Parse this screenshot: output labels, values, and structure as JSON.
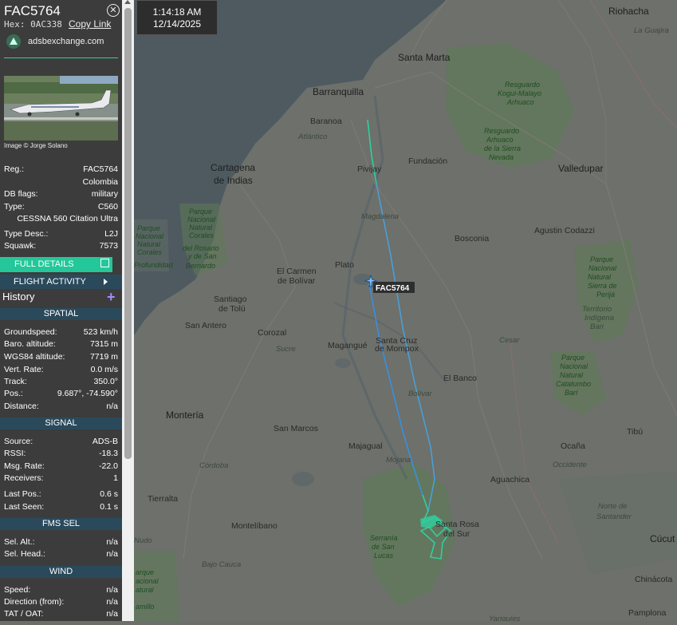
{
  "aircraft": {
    "callsign": "FAC5764",
    "hex_label": "Hex:",
    "hex": "0AC338",
    "copy_link": "Copy Link",
    "site": "adsbexchange.com",
    "image_credit": "Image © Jorge Solano"
  },
  "details": [
    {
      "k": "Reg.:",
      "v": "FAC5764"
    },
    {
      "k": "",
      "v": "Colombia"
    },
    {
      "k": "DB flags:",
      "v": "military"
    },
    {
      "k": "Type:",
      "v": "C560"
    },
    {
      "k": "",
      "v": "CESSNA 560 Citation Ultra"
    },
    {
      "k": "Type Desc.:",
      "v": "L2J"
    },
    {
      "k": "Squawk:",
      "v": "7573"
    }
  ],
  "buttons": {
    "full_details": "FULL DETAILS",
    "flight_activity": "FLIGHT ACTIVITY",
    "history": "History",
    "plus": "+"
  },
  "sections": {
    "spatial": "SPATIAL",
    "signal": "SIGNAL",
    "fms": "FMS SEL",
    "wind": "WIND"
  },
  "spatial": [
    {
      "k": "Groundspeed:",
      "v": "523 km/h"
    },
    {
      "k": "Baro. altitude:",
      "v": "7315 m"
    },
    {
      "k": "WGS84 altitude:",
      "v": "7719 m"
    },
    {
      "k": "Vert. Rate:",
      "v": "0.0 m/s"
    },
    {
      "k": "Track:",
      "v": "350.0°"
    },
    {
      "k": "Pos.:",
      "v": "9.687°, -74.590°"
    },
    {
      "k": "Distance:",
      "v": "n/a"
    }
  ],
  "signal": [
    {
      "k": "Source:",
      "v": "ADS-B"
    },
    {
      "k": "RSSI:",
      "v": "-18.3"
    },
    {
      "k": "Msg. Rate:",
      "v": "-22.0"
    },
    {
      "k": "Receivers:",
      "v": "1"
    },
    {
      "k": "Last Pos.:",
      "v": "0.6 s"
    },
    {
      "k": "Last Seen:",
      "v": "0.1 s"
    }
  ],
  "fms": [
    {
      "k": "Sel. Alt.:",
      "v": "n/a"
    },
    {
      "k": "Sel. Head.:",
      "v": "n/a"
    }
  ],
  "wind": [
    {
      "k": "Speed:",
      "v": "n/a"
    },
    {
      "k": "Direction (from):",
      "v": "n/a"
    },
    {
      "k": "TAT / OAT:",
      "v": "n/a"
    }
  ],
  "clock": {
    "time": "1:14:18 AM",
    "date": "12/14/2025"
  },
  "map": {
    "aircraft_label": "FAC5764",
    "places": {
      "riohacha": "Riohacha",
      "la_guajira": "La Guajira",
      "santa_marta": "Santa Marta",
      "barranquilla": "Barranquilla",
      "resguardo1": "Resguardo",
      "resguardo1b": "Kogui-Malayo",
      "resguardo1c": "Arhuaco",
      "resguardo2": "Resguardo",
      "resguardo2b": "Arhuaco",
      "resguardo2c": "de la Sierra",
      "resguardo2d": "Nevada",
      "baranoa": "Baranoa",
      "atlantico": "Atlántico",
      "fundacion": "Fundación",
      "valledupar": "Valledupar",
      "cartagena": "Cartagena",
      "de_indias": "de Indias",
      "pivijay": "Pivijay",
      "magdalena": "Magdalena",
      "agustin": "Agustin Codazzi",
      "bosconia": "Bosconia",
      "parque1a": "Parque",
      "parque1b": "Nacional",
      "parque1c": "Natural",
      "parque1d": "Corales",
      "parque1e": "Profundidad",
      "parque2a": "Parque",
      "parque2b": "Nacional",
      "parque2c": "Natural",
      "parque2d": "Corales",
      "parque2e": "del Rosario",
      "parque2f": "y de San",
      "parque2g": "Bernardo",
      "plato": "Plato",
      "el_carmen": "El Carmen",
      "de_bolivar": "de Bolívar",
      "parque3a": "Parque",
      "parque3b": "Nacional",
      "parque3c": "Natural",
      "parque3d": "Sierra de",
      "parque3e": "Perijá",
      "territorio1": "Territorio",
      "territorio2": "Indígena",
      "territorio3": "Bari",
      "santiago": "Santiago",
      "de_tolu": "de Tolú",
      "san_antero": "San Antero",
      "corozal": "Corozal",
      "magangue": "Magangué",
      "santa_cruz": "Santa Cruz",
      "de_mompox": "de Mompox",
      "sucre": "Sucre",
      "cesar": "Cesar",
      "el_banco": "El Banco",
      "parque4a": "Parque",
      "parque4b": "Nacional",
      "parque4c": "Natural",
      "parque4d": "Catatumbo",
      "parque4e": "Barí",
      "monteria": "Montería",
      "bolivar": "Bolívar",
      "san_marcos": "San Marcos",
      "tibu": "Tibú",
      "majagual": "Majagual",
      "cordoba": "Córdoba",
      "mojana": "Mojana",
      "ocaña": "Ocaña",
      "occidente": "Occidente",
      "aguachica": "Aguachica",
      "tierralta": "Tierralta",
      "santa_rosa": "Santa Rosa",
      "del_sur": "del Sur",
      "norte1": "Norte de",
      "norte2": "Santander",
      "montelibano": "Montelíbano",
      "serrania1": "Serranía",
      "serrania2": "de San",
      "serrania3": "Lucas",
      "nudo": "Nudo",
      "cucuta": "Cúcut",
      "bajo_cauca": "Bajo Cauca",
      "parque5a": "arque",
      "parque5b": "acional",
      "parque5c": "atural",
      "parque5d": "amillo",
      "chinacota": "Chinácota",
      "pamplona": "Pamplona",
      "yariguies": "Yariguíes"
    }
  }
}
